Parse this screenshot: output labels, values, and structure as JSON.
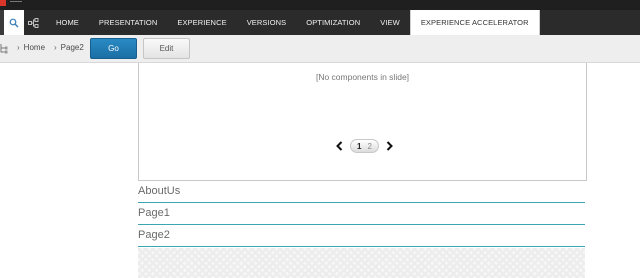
{
  "ribbon": {
    "tools": [
      {
        "icon": "search-icon"
      },
      {
        "icon": "sitemap-icon"
      }
    ],
    "tabs": [
      {
        "label": "HOME",
        "active": false
      },
      {
        "label": "PRESENTATION",
        "active": false
      },
      {
        "label": "EXPERIENCE",
        "active": false
      },
      {
        "label": "VERSIONS",
        "active": false
      },
      {
        "label": "OPTIMIZATION",
        "active": false
      },
      {
        "label": "VIEW",
        "active": false
      },
      {
        "label": "EXPERIENCE ACCELERATOR",
        "active": true
      }
    ]
  },
  "toolbar": {
    "breadcrumb": [
      "Home",
      "Page2"
    ],
    "go_label": "Go",
    "edit_label": "Edit"
  },
  "slide": {
    "empty_text": "[No components in slide]",
    "pages": [
      "1",
      "2"
    ],
    "current_page": "1"
  },
  "nav": {
    "items": [
      "AboutUs",
      "Page1",
      "Page2"
    ]
  },
  "colors": {
    "accent": "#1a6fa5",
    "divider": "#3aa6b0",
    "ribbon": "#2b2b2b"
  }
}
